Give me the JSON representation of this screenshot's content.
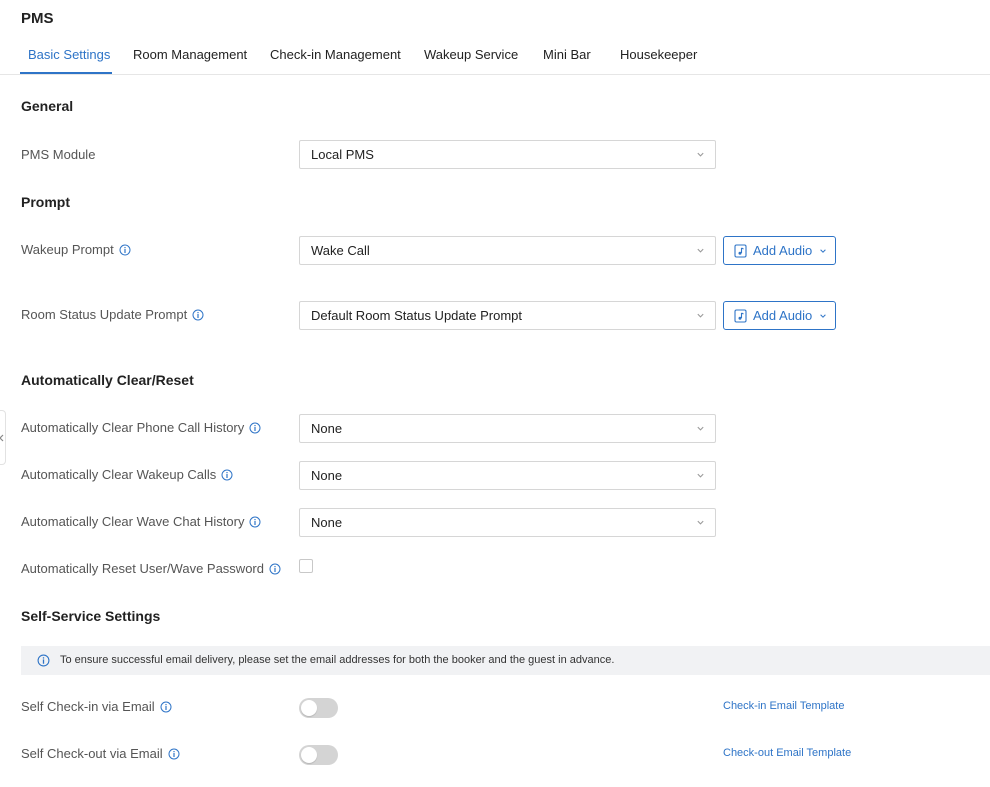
{
  "page": {
    "title": "PMS"
  },
  "tabs": [
    {
      "label": "Basic Settings",
      "active": true
    },
    {
      "label": "Room Management"
    },
    {
      "label": "Check-in Management"
    },
    {
      "label": "Wakeup Service"
    },
    {
      "label": "Mini Bar"
    },
    {
      "label": "Housekeeper"
    }
  ],
  "general": {
    "title": "General",
    "pms_module": {
      "label": "PMS Module",
      "value": "Local PMS"
    }
  },
  "prompt": {
    "title": "Prompt",
    "wakeup": {
      "label": "Wakeup Prompt",
      "value": "Wake Call",
      "button": "Add Audio"
    },
    "room_status": {
      "label": "Room Status Update Prompt",
      "value": "Default Room Status Update Prompt",
      "button": "Add Audio"
    }
  },
  "auto_clear": {
    "title": "Automatically Clear/Reset",
    "phone_call_history": {
      "label": "Automatically Clear Phone Call History",
      "value": "None"
    },
    "wakeup_calls": {
      "label": "Automatically Clear Wakeup Calls",
      "value": "None"
    },
    "wave_chat_history": {
      "label": "Automatically Clear Wave Chat History",
      "value": "None"
    },
    "reset_password": {
      "label": "Automatically Reset User/Wave Password",
      "checked": false
    }
  },
  "self_service": {
    "title": "Self-Service Settings",
    "notice": "To ensure successful email delivery, please set the email addresses for both the booker and the guest in advance.",
    "check_in": {
      "label": "Self Check-in via Email",
      "enabled": false,
      "link": "Check-in Email Template"
    },
    "check_out": {
      "label": "Self Check-out via Email",
      "enabled": false,
      "link": "Check-out Email Template"
    }
  },
  "colors": {
    "accent": "#2e74c7",
    "toggle_off": "#d4d4d4",
    "notice_bg": "#f1f2f4"
  },
  "icons": [
    "info-icon",
    "chevron-down-icon",
    "audio-file-icon",
    "collapse-arrow-icon"
  ]
}
